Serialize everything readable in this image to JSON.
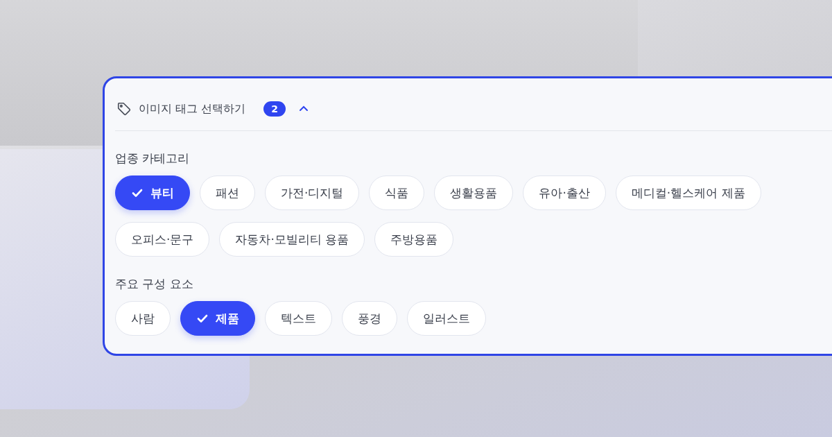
{
  "panel": {
    "title": "이미지 태그 선택하기",
    "count": "2",
    "expanded": true
  },
  "sections": [
    {
      "label": "업종 카테고리",
      "chips": [
        {
          "label": "뷰티",
          "selected": true
        },
        {
          "label": "패션",
          "selected": false
        },
        {
          "label": "가전·디지털",
          "selected": false
        },
        {
          "label": "식품",
          "selected": false
        },
        {
          "label": "생활용품",
          "selected": false
        },
        {
          "label": "유아·출산",
          "selected": false
        },
        {
          "label": "메디컬·헬스케어 제품",
          "selected": false
        },
        {
          "label": "오피스·문구",
          "selected": false
        },
        {
          "label": "자동차·모빌리티 용품",
          "selected": false
        },
        {
          "label": "주방용품",
          "selected": false
        }
      ]
    },
    {
      "label": "주요 구성 요소",
      "chips": [
        {
          "label": "사람",
          "selected": false
        },
        {
          "label": "제품",
          "selected": true
        },
        {
          "label": "텍스트",
          "selected": false
        },
        {
          "label": "풍경",
          "selected": false
        },
        {
          "label": "일러스트",
          "selected": false
        }
      ]
    }
  ]
}
